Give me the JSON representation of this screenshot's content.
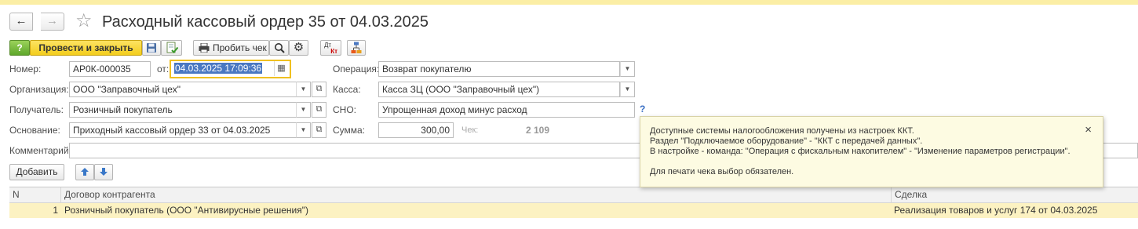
{
  "window": {
    "title": "Расходный кассовый ордер 35 от 04.03.2025"
  },
  "toolbar": {
    "help_label": "?",
    "post_close_label": "Провести и закрыть",
    "print_receipt_label": "Пробить чек",
    "dt_kt_top": "Дт",
    "dt_kt_bottom": "Кт"
  },
  "form": {
    "number_label": "Номер:",
    "number_value": "АР0К-000035",
    "date_label": "от:",
    "date_value": "04.03.2025 17:09:36",
    "operation_label": "Операция:",
    "operation_value": "Возврат покупателю",
    "organization_label": "Организация:",
    "organization_value": "ООО \"Заправочный цех\"",
    "cashbox_label": "Касса:",
    "cashbox_value": "Касса ЗЦ (ООО \"Заправочный цех\")",
    "recipient_label": "Получатель:",
    "recipient_value": "Розничный покупатель",
    "tax_label": "СНО:",
    "tax_value": "Упрощенная доход минус расход",
    "tax_help": "?",
    "basis_label": "Основание:",
    "basis_value": "Приходный кассовый ордер 33 от 04.03.2025",
    "amount_label": "Сумма:",
    "amount_value": "300,00",
    "receipt_label": "Чек:",
    "receipt_value": "2 109",
    "comment_label": "Комментарий:",
    "comment_value": ""
  },
  "table_toolbar": {
    "add_label": "Добавить",
    "up_icon": "arrow-up-icon",
    "down_icon": "arrow-down-icon"
  },
  "tooltip": {
    "lines": [
      "Доступные системы налогообложения получены из настроек ККТ.",
      "Раздел \"Подключаемое оборудование\" - \"ККТ с передачей данных\".",
      "В настройке - команда: \"Операция с фискальным накопителем\" - \"Изменение параметров регистрации\".",
      "",
      "Для печати чека выбор обязателен."
    ],
    "close": "×"
  },
  "table": {
    "columns": [
      "N",
      "Договор контрагента",
      "Сделка"
    ],
    "rows": [
      [
        "1",
        "Розничный покупатель (ООО \"Антивирусные решения\")",
        "Реализация товаров и услуг 174 от 04.03.2025"
      ]
    ]
  },
  "colors": {
    "accent_yellow": "#f3cd1c",
    "selected_row": "#fcf2c2",
    "tooltip_bg": "#fdfbe2",
    "help_green": "#5ea72b",
    "focus_border": "#f0c020"
  }
}
